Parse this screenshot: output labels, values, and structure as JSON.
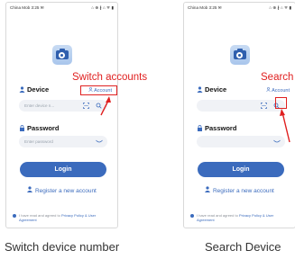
{
  "left_screen": {
    "status_left": "China Mob 3:25 ✉",
    "status_right": "⌂ ⊕ ∦ ⌂ ᯤ ▮",
    "device_label": "Device",
    "account_link": "Account",
    "device_placeholder": "Enter device n...",
    "password_label": "Password",
    "password_placeholder": "Enter password",
    "login_label": "Login",
    "register_label": "Register a new account",
    "agree_prefix": "I have read and agreed to",
    "agree_policy": "Privacy Policy & User Agreement"
  },
  "right_screen": {
    "status_left": "China Mob 3:25 ✉",
    "status_right": "⌂ ⊕ ∦ ⌂ ᯤ ▮",
    "device_label": "Device",
    "account_link": "Account",
    "password_label": "Password",
    "login_label": "Login",
    "register_label": "Register a new account",
    "agree_prefix": "I have read and agreed to",
    "agree_policy": "Privacy Policy & User Agreement"
  },
  "annotations": {
    "left_callout": "Switch accounts",
    "right_callout": "Search",
    "left_caption": "Switch device number",
    "right_caption": "Search Device"
  },
  "colors": {
    "accent": "#3b6bbd",
    "annotation": "#e02020",
    "input_bg": "#f0f2f6"
  },
  "icons": [
    "camera-logo-icon",
    "user-icon",
    "lock-icon",
    "scan-icon",
    "search-icon",
    "eye-icon",
    "add-user-icon"
  ]
}
